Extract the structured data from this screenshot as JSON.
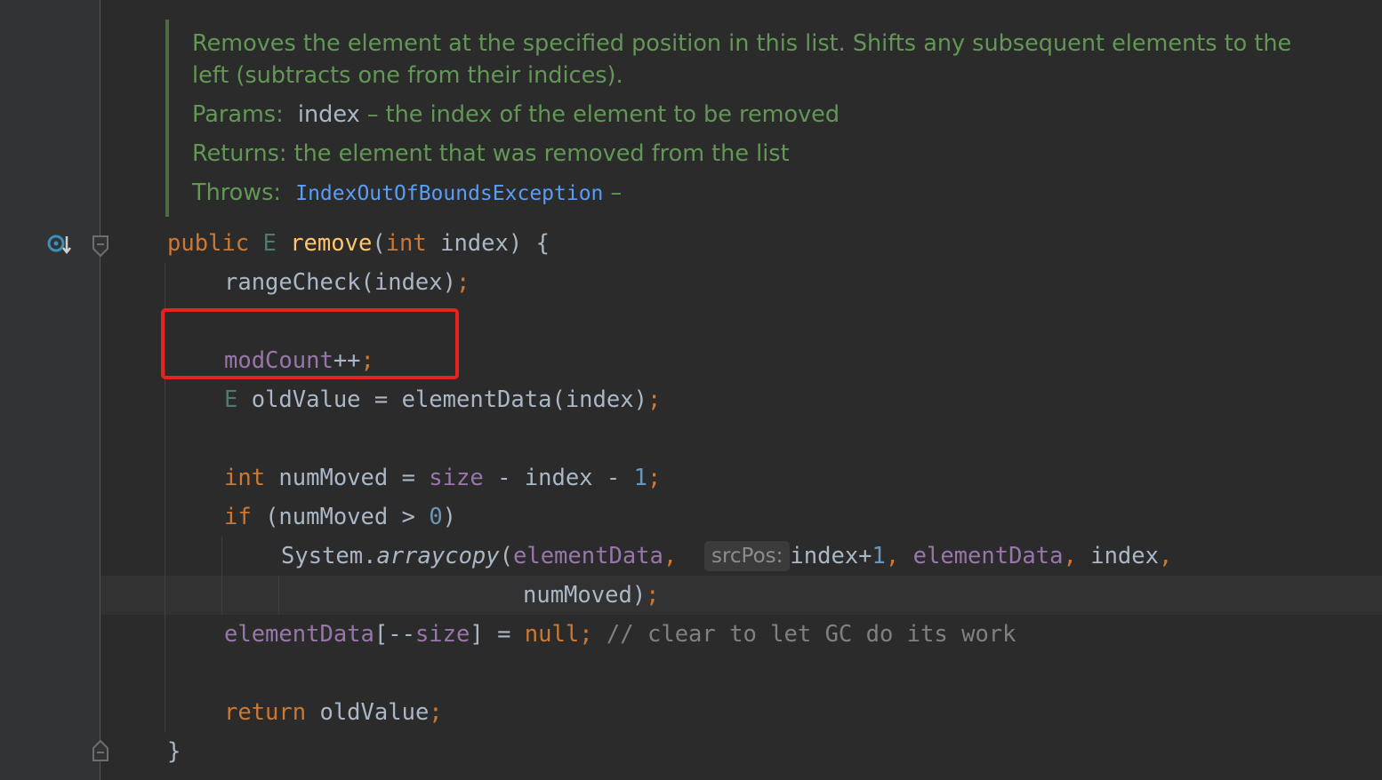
{
  "doc": {
    "description_line1": "Removes the element at the specified position in this list. Shifts any subsequent elements to the",
    "description_line2": "left (subtracts one from their indices).",
    "params_label": "Params:",
    "params_name": "index",
    "params_desc": "– the index of the element to be removed",
    "returns_label": "Returns:",
    "returns_desc": "the element that was removed from the list",
    "throws_label": "Throws:",
    "throws_exception": "IndexOutOfBoundsException",
    "throws_dash": "–"
  },
  "code": {
    "l1_public": "public",
    "l1_type": "E",
    "l1_method": "remove",
    "l1_open": "(",
    "l1_int": "int",
    "l1_rest": " index) {",
    "l2": "rangeCheck(index)",
    "l2_semi": ";",
    "l3_field": "modCount",
    "l3_op": "++",
    "l3_semi": ";",
    "l4_type": "E",
    "l4_rest": " oldValue = elementData(index)",
    "l4_semi": ";",
    "l5_int": "int",
    "l5_mid": " numMoved = ",
    "l5_size": "size",
    "l5_mid2": " - index - ",
    "l5_one": "1",
    "l5_semi": ";",
    "l6_if": "if",
    "l6_mid": " (numMoved > ",
    "l6_zero": "0",
    "l6_close": ")",
    "l7_system": "System.",
    "l7_method": "arraycopy",
    "l7_open": "(",
    "l7_field": "elementData",
    "l7_comma": ",",
    "l7_hint": "srcPos:",
    "l7_index": "index+",
    "l7_one": "1",
    "l7_comma2": ", ",
    "l7_field2": "elementData",
    "l7_comma3": ", ",
    "l7_index2": "index",
    "l7_comma4": ",",
    "l8_num": "numMoved)",
    "l8_semi": ";",
    "l9_field": "elementData",
    "l9_mid": "[--",
    "l9_size": "size",
    "l9_mid2": "] = ",
    "l9_null": "null",
    "l9_semi": ";",
    "l9_comment": " // clear to let GC do its work",
    "l10_return": "return",
    "l10_rest": " oldValue",
    "l10_semi": ";",
    "l11": "}"
  },
  "icons": {
    "override": "override-method-icon",
    "fold": "fold-marker-icon"
  },
  "colors": {
    "background": "#2b2b2b",
    "doc_text": "#629755",
    "keyword": "#cc7832",
    "field": "#9876aa",
    "highlight_box": "#e8231d"
  }
}
